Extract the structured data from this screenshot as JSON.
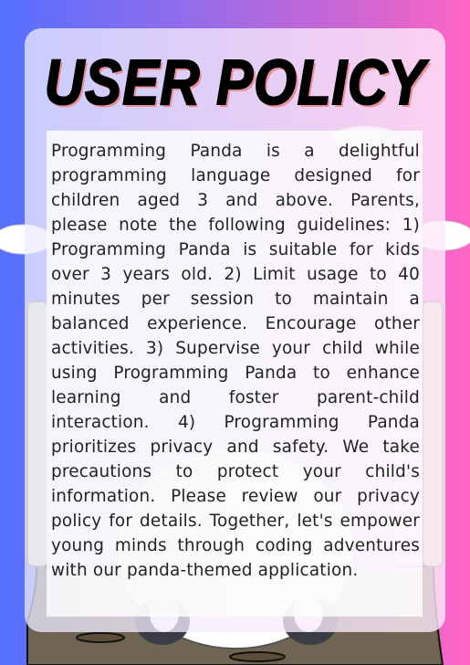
{
  "title": "USER POLICY",
  "body": "Programming Panda is a delightful programming language designed for children aged 3 and above. Parents, please note the following guidelines: 1) Programming Panda is suitable for kids over 3 years old. 2) Limit usage to 40 minutes per session to maintain a balanced experience. Encourage other activities. 3) Supervise your child while using Programming Panda to enhance learning and foster parent-child interaction. 4) Programming Panda prioritizes privacy and safety. We take precautions to protect your child's information. Please review our privacy policy for details. Together, let's empower young minds through coding adventures with our panda-themed application.",
  "colors": {
    "gradient_left": "#5470ff",
    "gradient_right": "#ff66c4",
    "title_shadow": "#e8909a",
    "ground": "#7a6e5a"
  }
}
